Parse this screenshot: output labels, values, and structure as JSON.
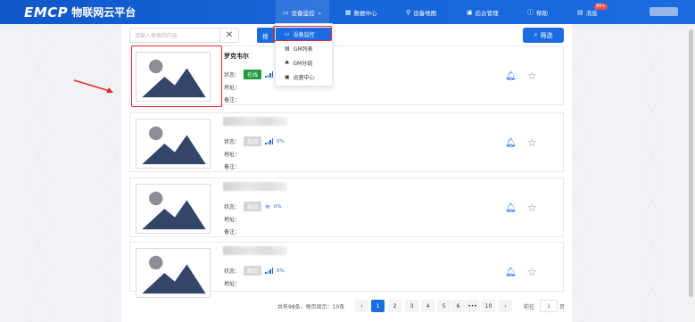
{
  "header": {
    "brand": "EMCP",
    "brand_cn": "物联网云平台",
    "nav": [
      {
        "label": "设备监控",
        "icon": "monitor-icon",
        "caret": "⌄"
      },
      {
        "label": "数据中心",
        "icon": "data-icon"
      },
      {
        "label": "设备地图",
        "icon": "map-pin-icon"
      },
      {
        "label": "后台管理",
        "icon": "admin-icon"
      },
      {
        "label": "帮助",
        "icon": "help-icon"
      },
      {
        "label": "消息",
        "icon": "message-icon",
        "badge": "99+"
      }
    ]
  },
  "toolbar": {
    "search_placeholder": "请输入搜索的内容",
    "clear": "✕",
    "search_label": "搜",
    "filter_label": "筛选"
  },
  "dropdown": {
    "items": [
      {
        "label": "设备监控",
        "icon": "monitor-icon",
        "selected": true
      },
      {
        "label": "GM列表",
        "icon": "list-icon",
        "selected": false
      },
      {
        "label": "GM分组",
        "icon": "group-icon",
        "selected": false
      },
      {
        "label": "运营中心",
        "icon": "operation-icon",
        "selected": false
      }
    ]
  },
  "devices": [
    {
      "name": "罗克韦尔",
      "status_label": "状态：",
      "status": "在线",
      "address_label": "地址：",
      "note_label": "备注：",
      "signal_pct": "",
      "signal_type": "bars"
    },
    {
      "name": "",
      "status_label": "状态：",
      "status": "离线",
      "address_label": "地址：",
      "note_label": "备注：",
      "signal_pct": "0%",
      "signal_type": "bars"
    },
    {
      "name": "",
      "status_label": "状态：",
      "status": "离线",
      "address_label": "地址：",
      "note_label": "备注：",
      "signal_pct": "0%",
      "signal_type": "wifi"
    },
    {
      "name": "",
      "status_label": "状态：",
      "status": "离线",
      "address_label": "地址：",
      "note_label": "",
      "signal_pct": "0%",
      "signal_type": "bars"
    }
  ],
  "pagination": {
    "total_text": "共有98条，每页显示：10条",
    "prev": "‹",
    "next": "›",
    "pages": [
      "1",
      "2",
      "3",
      "4",
      "5",
      "6",
      "•••",
      "10"
    ],
    "current": "1",
    "goto_label": "前往",
    "goto_value": "1",
    "goto_suffix": "页"
  },
  "colors": {
    "primary": "#1a6ce0",
    "online": "#1f9b3e",
    "offline": "#d4d6da",
    "highlight": "#e8262d"
  }
}
